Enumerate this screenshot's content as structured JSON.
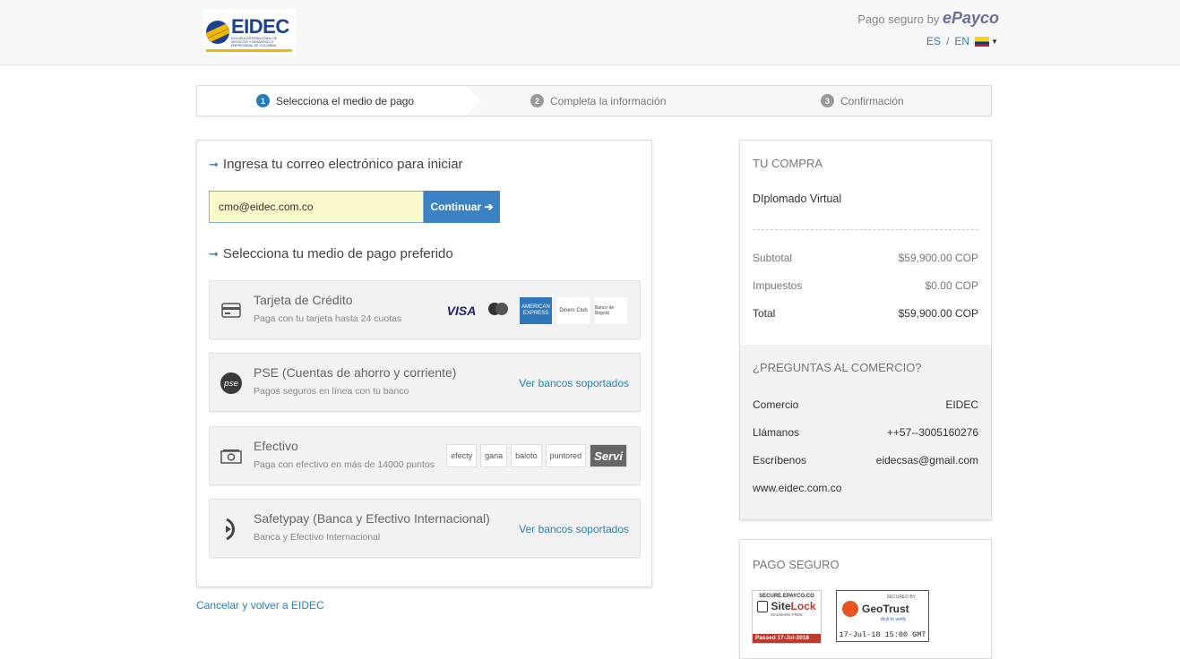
{
  "header": {
    "logo_name": "EIDEC",
    "logo_sub": "ESCUELA INTERNACIONAL DE NEGOCIOS Y DESARROLLO EMPRESARIAL DE COLOMBIA",
    "secure_by_text": "Pago seguro by",
    "secure_by_brand": "ePayco",
    "lang_es": "ES",
    "lang_sep": "/",
    "lang_en": "EN"
  },
  "steps": [
    {
      "num": "1",
      "label": "Selecciona el medio de pago"
    },
    {
      "num": "2",
      "label": "Completa la información"
    },
    {
      "num": "3",
      "label": "Confirmación"
    }
  ],
  "main": {
    "email_title": "Ingresa tu correo electrónico para iniciar",
    "email_value": "cmo@eidec.com.co",
    "continue_label": "Continuar ➔",
    "methods_title": "Selecciona tu medio de pago preferido",
    "methods": [
      {
        "title": "Tarjeta de Crédito",
        "subtitle": "Paga con tu tarjeta hasta 24 cuotas"
      },
      {
        "title": "PSE (Cuentas de ahorro y corriente)",
        "subtitle": "Pagos seguros en línea con tu banco",
        "link": "Ver bancos soportados"
      },
      {
        "title": "Efectivo",
        "subtitle": "Paga con efectivo en más de 14000 puntos"
      },
      {
        "title": "Safetypay (Banca y Efectivo Internacional)",
        "subtitle": "Banca y Efectivo Internacional",
        "link": "Ver bancos soportados"
      }
    ],
    "card_logos": {
      "visa": "VISA",
      "amex": "AMERICAN EXPRESS",
      "diners": "Diners Club",
      "bogota": "Banco de Bogotá"
    },
    "cash_logos": [
      "efecty",
      "gana",
      "baloto",
      "puntored",
      "Servi"
    ],
    "cancel_link": "Cancelar y volver a EIDEC"
  },
  "summary": {
    "title": "TU COMPRA",
    "product": "DIplomado Virtual",
    "subtotal_label": "Subtotal",
    "subtotal_value": "$59,900.00 COP",
    "tax_label": "Impuestos",
    "tax_value": "$0.00 COP",
    "total_label": "Total",
    "total_value": "$59,900.00 COP",
    "questions_title": "¿PREGUNTAS AL COMERCIO?",
    "merchant_label": "Comercio",
    "merchant_value": "EIDEC",
    "call_label": "Llámanos",
    "call_value": "++57--3005160276",
    "write_label": "Escríbenos",
    "write_value": "eidecsas@gmail.com",
    "website": "www.eidec.com.co"
  },
  "secure": {
    "title": "PAGO SEGURO",
    "sitelock_top": "SECURE.EPAYCO.CO",
    "sitelock_name_a": "Site",
    "sitelock_name_b": "Lock",
    "sitelock_sub": "MALWARE-FREE",
    "sitelock_passed": "Passed  17-Jul-2018",
    "geotrust_top": "SECURED BY",
    "geotrust_name": "GeoTrust",
    "geotrust_click": "click to verify",
    "geotrust_date": "17-Jul-18 15:00 GMT"
  },
  "colors": {
    "accent": "#1f7bc4",
    "button": "#3b82c4",
    "link": "#2980b9"
  }
}
